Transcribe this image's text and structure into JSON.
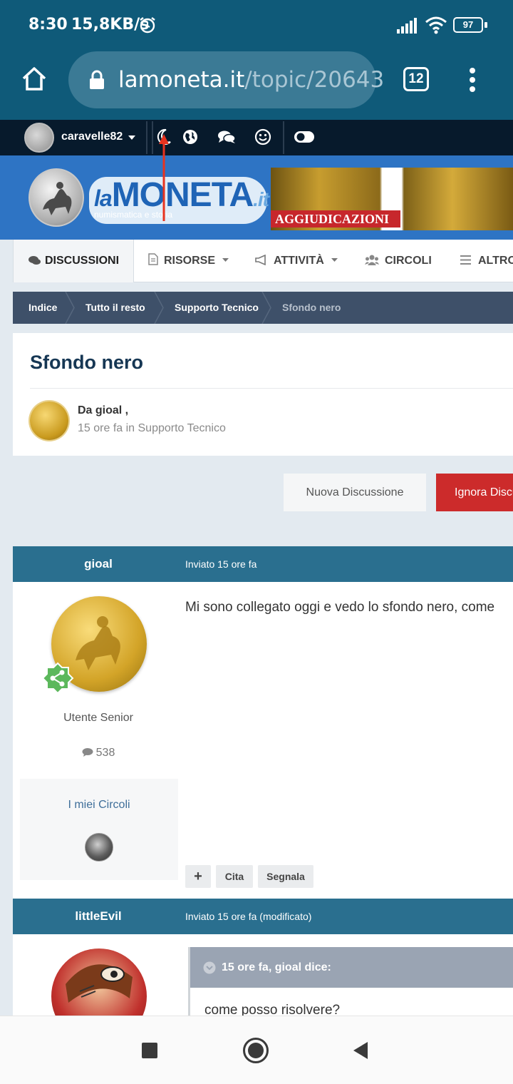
{
  "status_bar": {
    "time": "8:30",
    "speed": "15,8KB/s",
    "battery": "97"
  },
  "browser": {
    "url_domain": "lamoneta.it",
    "url_path": "/topic/20643",
    "tab_count": "12"
  },
  "user_bar": {
    "username": "caravelle82"
  },
  "header": {
    "banner_text": "AGGIUDICAZIONI"
  },
  "nav": {
    "items": [
      "DISCUSSIONI",
      "RISORSE",
      "ATTIVITÀ",
      "CIRCOLI",
      "ALTRO"
    ]
  },
  "breadcrumbs": [
    "Indice",
    "Tutto il resto",
    "Supporto Tecnico",
    "Sfondo nero"
  ],
  "topic": {
    "title": "Sfondo nero",
    "author": "Da gioal ,",
    "meta": "15 ore fa in Supporto Tecnico"
  },
  "buttons": {
    "new_discussion": "Nuova Discussione",
    "ignore": "Ignora Discussione"
  },
  "post1": {
    "user": "gioal",
    "date": "Inviato 15 ore fa",
    "role": "Utente Senior",
    "post_count": "538",
    "circles_title": "I miei Circoli",
    "text": "Mi sono collegato oggi e vedo lo sfondo nero, come",
    "actions": {
      "plus": "+",
      "quote": "Cita",
      "report": "Segnala"
    }
  },
  "post2": {
    "user": "littleEvil",
    "date": "Inviato 15 ore fa (modificato)",
    "quote_header": "15 ore fa, gioal dice:",
    "quote_text": "come posso risolvere?"
  },
  "colors": {
    "chrome": "#0f5a79",
    "userbar": "#071a2c",
    "post_header": "#2a6f8f",
    "ignore_button": "#cc2b2b"
  }
}
